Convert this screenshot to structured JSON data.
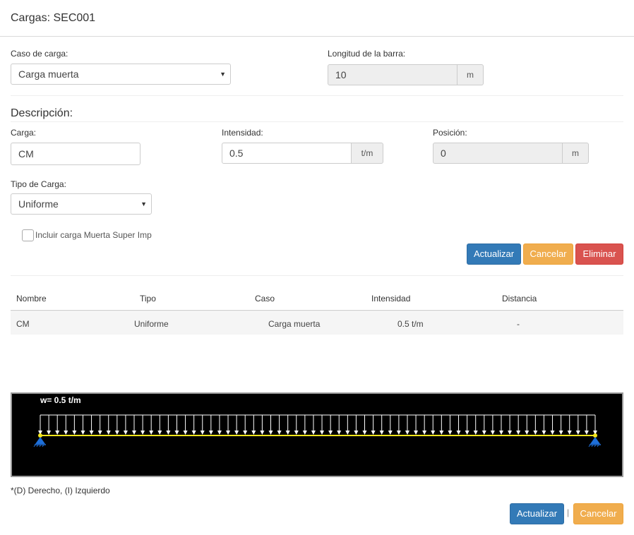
{
  "header": {
    "title": "Cargas: SEC001"
  },
  "case": {
    "label": "Caso de carga:",
    "selected": "Carga muerta"
  },
  "length": {
    "label": "Longitud de la barra:",
    "value": "10",
    "unit": "m"
  },
  "description": {
    "title": "Descripción:"
  },
  "load": {
    "label": "Carga:",
    "value": "CM"
  },
  "intensity": {
    "label": "Intensidad:",
    "value": "0.5",
    "unit": "t/m"
  },
  "position": {
    "label": "Posición:",
    "value": "0",
    "unit": "m"
  },
  "load_type": {
    "label": "Tipo de Carga:",
    "selected": "Uniforme"
  },
  "checkbox": {
    "label": "Incluir carga Muerta Super Imp",
    "checked": false
  },
  "actions": {
    "update": "Actualizar",
    "cancel": "Cancelar",
    "delete": "Eliminar"
  },
  "table": {
    "headers": [
      "Nombre",
      "Tipo",
      "Caso",
      "Intensidad",
      "Distancia"
    ],
    "rows": [
      [
        "CM",
        "Uniforme",
        "Carga muerta",
        "0.5 t/m",
        "-"
      ]
    ]
  },
  "diagram": {
    "label": "w= 0.5 t/m",
    "arrow_count": 66,
    "colors": {
      "background": "#000000",
      "arrows": "#ffffff",
      "beam": "#f5e61b",
      "support": "#1e6fd9"
    }
  },
  "footer": {
    "note": "*(D) Derecho, (I) Izquierdo",
    "update": "Actualizar",
    "separator": "|",
    "cancel": "Cancelar"
  }
}
